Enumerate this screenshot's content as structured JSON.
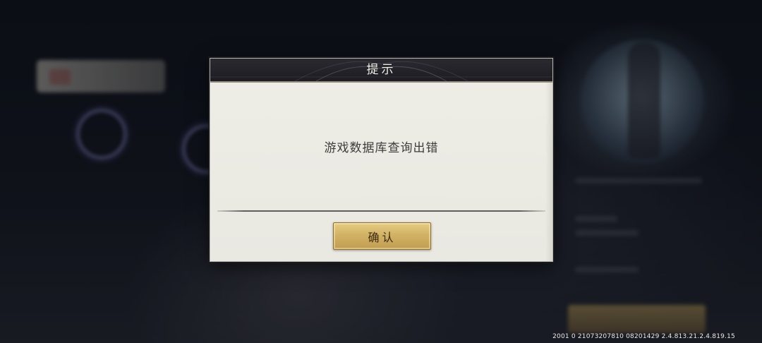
{
  "dialog": {
    "title": "提示",
    "message": "游戏数据库查询出错",
    "confirm_label": "确认"
  },
  "footer": {
    "version": "2001 0 21073207810 08201429 2.4.813.21.2.4.819.15"
  },
  "colors": {
    "dialog_body": "#eeede6",
    "dialog_header": "#1c1c22",
    "confirm_button": "#d2b265",
    "ring_glow": "#aaaaf0"
  }
}
